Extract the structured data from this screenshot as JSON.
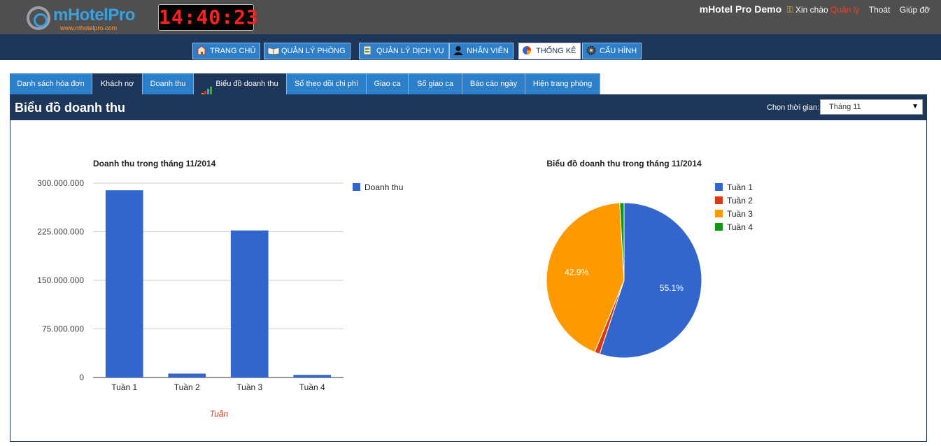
{
  "header": {
    "logo_text": "mHotelPro",
    "logo_subtext": "www.mhotelpro.com",
    "clock": "14:40:23",
    "app_name": "mHotel Pro Demo",
    "greeting": "Xin chào",
    "user": "Quản lý",
    "logout": "Thoát",
    "help": "Giúp đỡ"
  },
  "main_nav": [
    {
      "label": "TRANG CHỦ",
      "icon": "home-icon"
    },
    {
      "label": "QUẢN LÝ PHÒNG",
      "icon": "book-icon"
    },
    {
      "label": "QUẢN LÝ DỊCH VỤ",
      "icon": "service-icon"
    },
    {
      "label": "NHÂN VIÊN",
      "icon": "user-icon"
    },
    {
      "label": "THỐNG KÊ",
      "icon": "pie-icon",
      "active": true
    },
    {
      "label": "CẤU HÌNH",
      "icon": "gear-icon"
    }
  ],
  "sub_tabs": [
    {
      "label": "Danh sách hóa đơn"
    },
    {
      "label": "Khách nợ"
    },
    {
      "label": "Doanh thu"
    },
    {
      "label": "Biểu đồ doanh thu",
      "active": true
    },
    {
      "label": "Sổ theo dõi chi phí"
    },
    {
      "label": "Giao ca"
    },
    {
      "label": "Sổ giao ca"
    },
    {
      "label": "Báo cáo ngày"
    },
    {
      "label": "Hiện trang phòng"
    }
  ],
  "panel": {
    "title": "Biểu đồ doanh thu",
    "period_label": "Chọn thời gian:",
    "period_value": "Tháng 11"
  },
  "colors": {
    "accent": "#2e7fc9",
    "navy": "#1d3659",
    "bar": "#3366cc",
    "week1": "#3366cc",
    "week2": "#dc3912",
    "week3": "#ff9900",
    "week4": "#109618"
  },
  "chart_data": [
    {
      "type": "bar",
      "title": "Doanh thu trong tháng 11/2014",
      "categories": [
        "Tuần 1",
        "Tuần 2",
        "Tuần 3",
        "Tuần 4"
      ],
      "series": [
        {
          "name": "Doanh thu",
          "values": [
            289000000,
            6000000,
            227000000,
            4000000
          ]
        }
      ],
      "xlabel": "Tuần",
      "ylabel": "",
      "ylim": [
        0,
        300000000
      ],
      "yticks": [
        "0",
        "75.000.000",
        "150.000.000",
        "225.000.000",
        "300.000.000"
      ],
      "yticks_values": [
        0,
        75000000,
        150000000,
        225000000,
        300000000
      ],
      "grid": true,
      "legend": "right"
    },
    {
      "type": "pie",
      "title": "Biểu đồ doanh thu trong tháng 11/2014",
      "labels": [
        "Tuần 1",
        "Tuần 2",
        "Tuần 3",
        "Tuần 4"
      ],
      "values": [
        55.1,
        1.1,
        42.9,
        0.9
      ],
      "slice_labels": [
        "55.1%",
        "",
        "42.9%",
        ""
      ],
      "legend": "right"
    }
  ]
}
